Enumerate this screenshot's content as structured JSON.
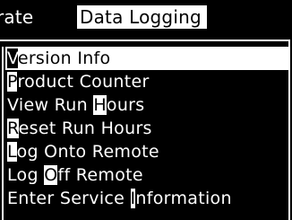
{
  "menubar": {
    "prev_tab": "rate",
    "active_tab": "Data Logging"
  },
  "menu": {
    "items": [
      {
        "hotkey": "V",
        "rest": "ersion Info",
        "selected": true
      },
      {
        "hotkey": "P",
        "rest": "roduct Counter"
      },
      {
        "pre": "View Run ",
        "hotkey": "H",
        "rest": "ours"
      },
      {
        "hotkey": "R",
        "rest": "eset Run Hours"
      },
      {
        "hotkey": "L",
        "rest": "og Onto Remote"
      },
      {
        "pre": "Log ",
        "hotkey": "O",
        "rest": "ff Remote"
      },
      {
        "pre": "Enter Service ",
        "hotkey": "I",
        "rest": "nformation"
      }
    ]
  },
  "colors": {
    "background": "#000000",
    "foreground": "#ffffff"
  }
}
